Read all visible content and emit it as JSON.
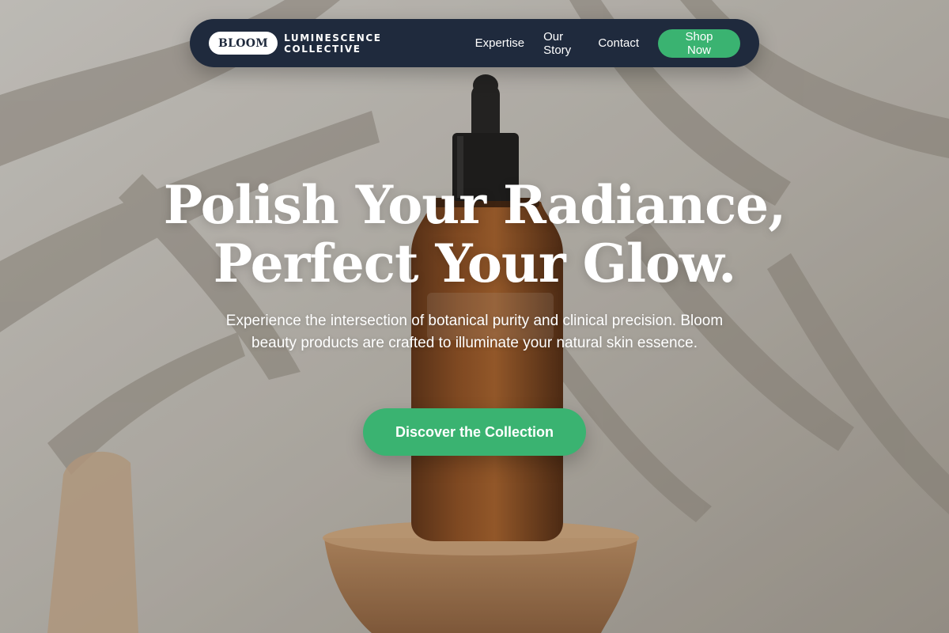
{
  "brand": {
    "logo": "BLOOM",
    "name": "LUMINESCENCE COLLECTIVE"
  },
  "nav": {
    "links": [
      "Expertise",
      "Our Story",
      "Contact"
    ],
    "cta": "Shop Now"
  },
  "hero": {
    "headline_line1": "Polish Your Radiance,",
    "headline_line2": "Perfect Your Glow.",
    "subtext": "Experience the intersection of botanical purity and clinical precision. Bloom beauty products are crafted to illuminate your natural skin essence.",
    "cta": "Discover the Collection",
    "image": "amber-serum-dropper-bottle-on-wooden-pedestal-with-leaf-shadows"
  },
  "colors": {
    "nav_background": "#1f2a3d",
    "accent_green": "#3ab371",
    "text_light": "#ffffff"
  }
}
